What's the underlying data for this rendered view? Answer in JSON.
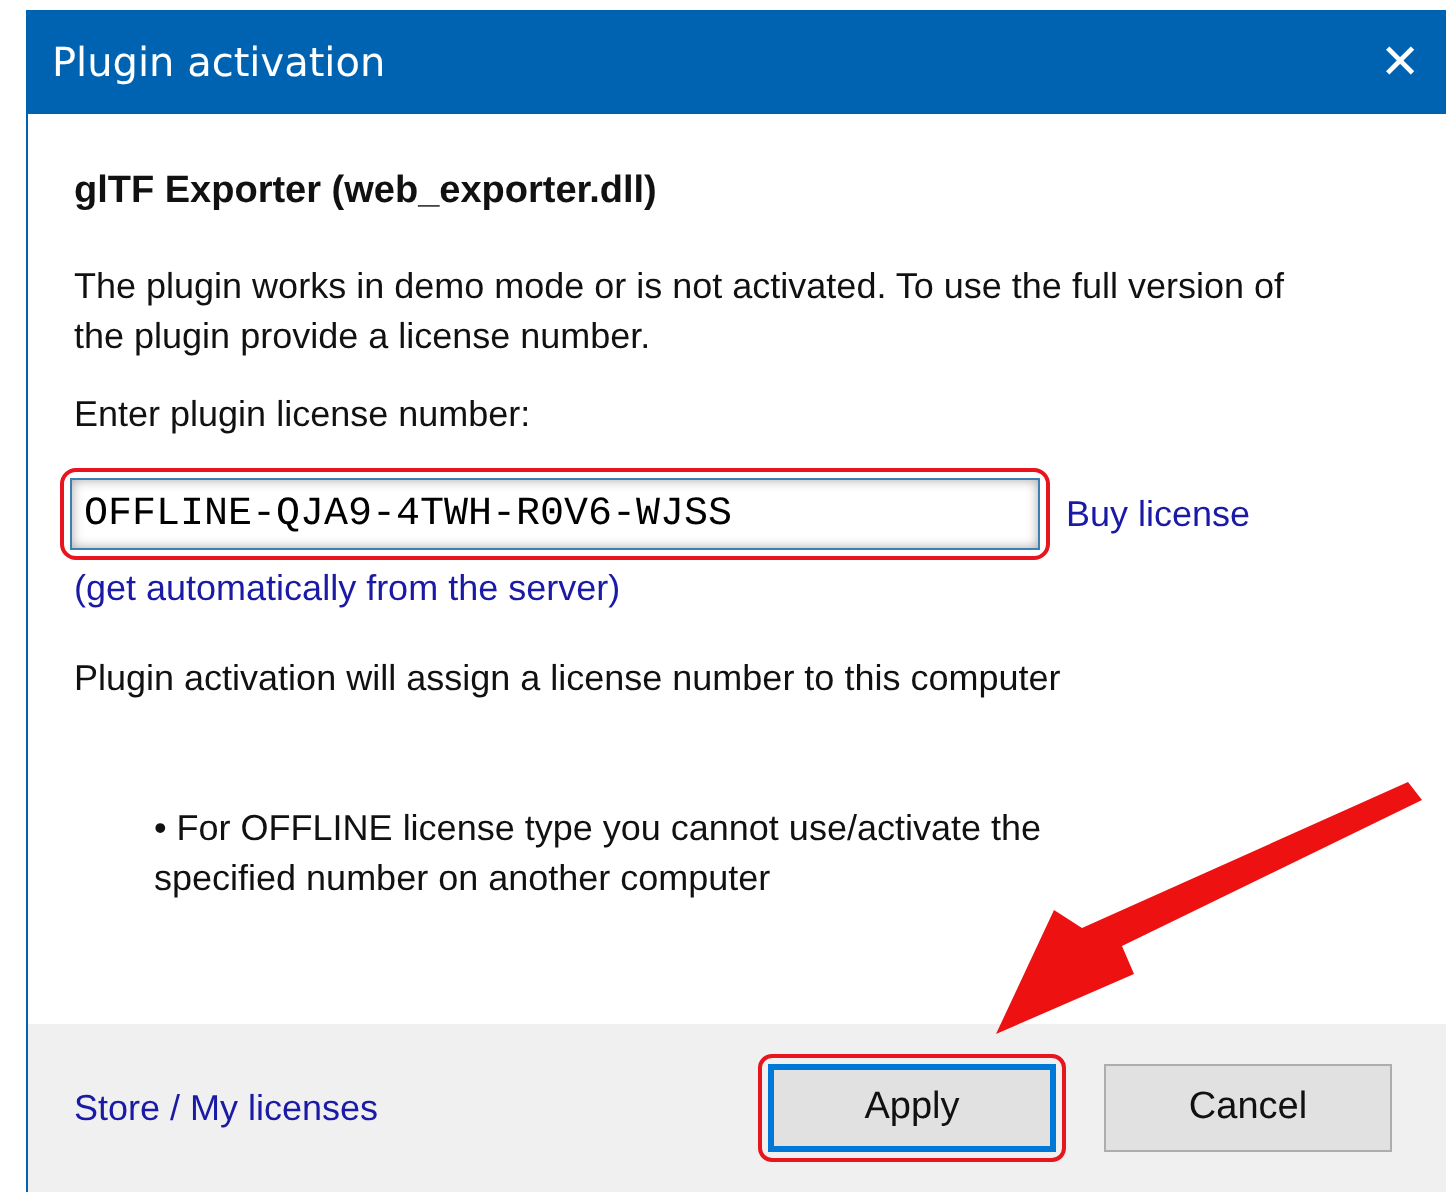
{
  "window": {
    "title": "Plugin activation",
    "close": "✕"
  },
  "plugin_name": "glTF Exporter (web_exporter.dll)",
  "description": "The plugin works in demo mode or is not activated. To use the full version of the plugin provide a license number.",
  "license_label": "Enter plugin license number:",
  "license_field": {
    "value": "OFFLINE-QJA9-4TWH-R0V6-WJSS",
    "highlighted": true
  },
  "buy_link": "Buy license",
  "auto_link": "(get automatically from the server)",
  "activation_note": "Plugin activation will assign a license number to this computer",
  "offline_note": "• For OFFLINE license type you cannot use/activate the specified number on another computer",
  "footer": {
    "store_link": "Store / My licenses",
    "buttons": [
      {
        "label": "Apply",
        "default": true,
        "highlighted": true
      },
      {
        "label": "Cancel",
        "default": false,
        "highlighted": false
      }
    ]
  },
  "annotation": {
    "kind": "arrow"
  }
}
